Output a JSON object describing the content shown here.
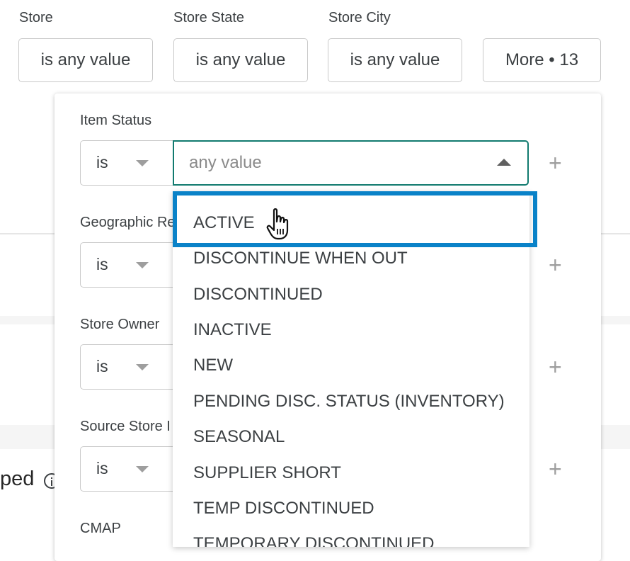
{
  "top_filters": [
    {
      "label": "Store",
      "value": "is any value"
    },
    {
      "label": "Store State",
      "value": "is any value"
    },
    {
      "label": "Store City",
      "value": "is any value"
    },
    {
      "label": "",
      "value": "More • 13"
    }
  ],
  "panel": {
    "filters": [
      {
        "label": "Item Status",
        "operator": "is"
      },
      {
        "label": "Geographic Re",
        "operator": "is"
      },
      {
        "label": "Store Owner",
        "operator": "is"
      },
      {
        "label": "Source Store I",
        "operator": "is"
      },
      {
        "label": "CMAP",
        "operator": ""
      }
    ],
    "value_placeholder": "any value",
    "plus": "+",
    "options": [
      "ACTIVE",
      "DISCONTINUE WHEN OUT",
      "DISCONTINUED",
      "INACTIVE",
      "NEW",
      "PENDING DISC. STATUS (INVENTORY)",
      "SEASONAL",
      "SUPPLIER SHORT",
      "TEMP DISCONTINUED",
      "TEMPORARY DISCONTINUED"
    ]
  },
  "background": {
    "partial_heading": "ped"
  },
  "colors": {
    "focus_border": "#117a6f",
    "highlight": "#0a82c8"
  },
  "icons": {
    "operator_dropdown": "chevron-down-icon",
    "value_dropdown": "chevron-up-icon",
    "add": "plus-icon",
    "cursor": "hand-pointer-icon",
    "info": "info-icon"
  }
}
